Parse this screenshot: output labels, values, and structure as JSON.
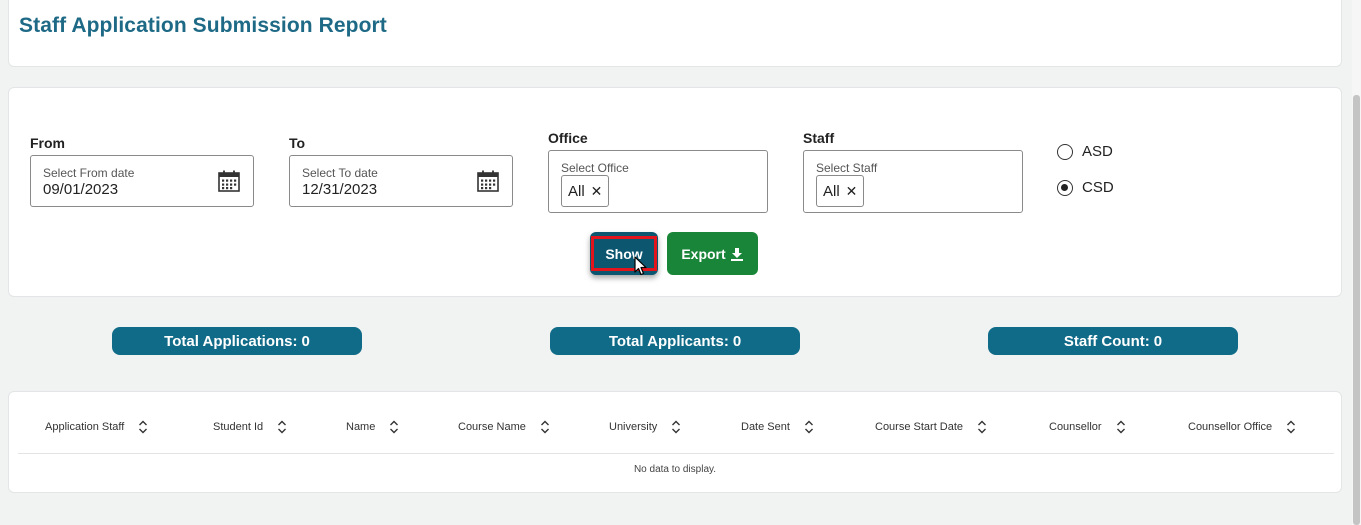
{
  "page": {
    "title": "Staff Application Submission Report"
  },
  "filters": {
    "from": {
      "label": "From",
      "placeholder": "Select From date",
      "value": "09/01/2023"
    },
    "to": {
      "label": "To",
      "placeholder": "Select To date",
      "value": "12/31/2023"
    },
    "office": {
      "label": "Office",
      "placeholder": "Select Office",
      "chip": "All",
      "remove": "✕"
    },
    "staff": {
      "label": "Staff",
      "placeholder": "Select Staff",
      "chip": "All",
      "remove": "✕"
    },
    "radios": [
      {
        "label": "ASD",
        "checked": false
      },
      {
        "label": "CSD",
        "checked": true
      }
    ]
  },
  "actions": {
    "show": "Show",
    "export": "Export"
  },
  "stats": [
    {
      "label": "Total Applications:",
      "value": "0"
    },
    {
      "label": "Total Applicants:",
      "value": "0"
    },
    {
      "label": "Staff Count:",
      "value": "0"
    }
  ],
  "table": {
    "columns": [
      "Application Staff",
      "Student Id",
      "Name",
      "Course Name",
      "University",
      "Date Sent",
      "Course Start Date",
      "Counsellor",
      "Counsellor Office"
    ],
    "empty_message": "No data to display."
  },
  "colors": {
    "title": "#1e6a86",
    "show_button": "#0d5670",
    "export_button": "#198538",
    "stat_pill": "#106b88",
    "highlight": "#e3141b"
  }
}
